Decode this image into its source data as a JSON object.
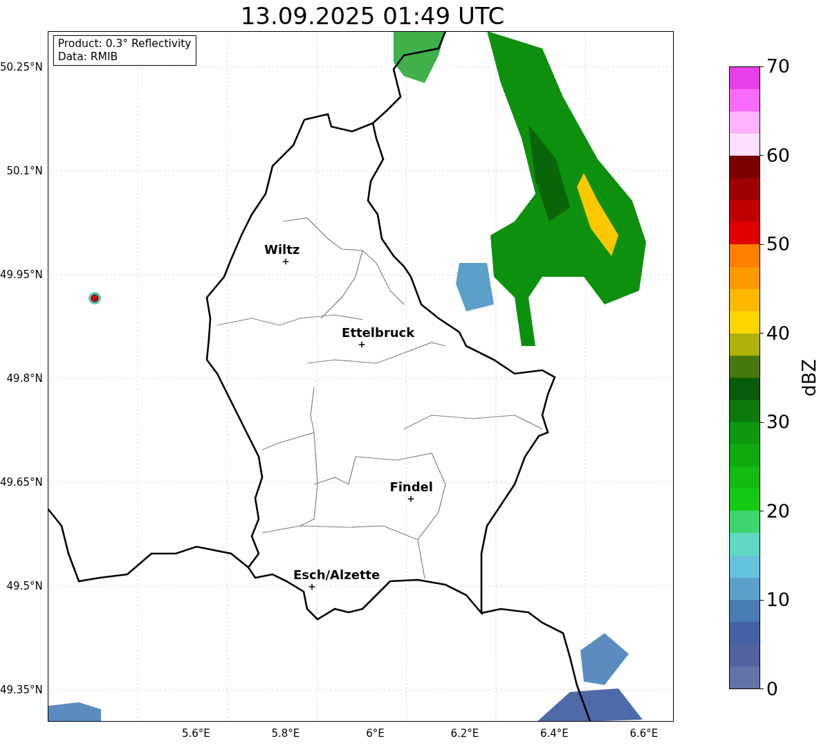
{
  "title": "13.09.2025 01:49 UTC",
  "info_box": [
    "Product: 0.3° Reflectivity",
    "Data: RMIB"
  ],
  "map": {
    "lat_ticks": [
      "50.25°N",
      "50.1°N",
      "49.95°N",
      "49.8°N",
      "49.65°N",
      "49.5°N",
      "49.35°N"
    ],
    "lon_ticks": [
      "5.6°E",
      "5.8°E",
      "6°E",
      "6.2°E",
      "6.4°E",
      "6.6°E"
    ],
    "places": [
      {
        "name": "Wiltz"
      },
      {
        "name": "Ettelbruck"
      },
      {
        "name": "Findel"
      },
      {
        "name": "Esch/Alzette"
      }
    ]
  },
  "colorbar": {
    "label": "dBZ",
    "ticks": [
      "70",
      "60",
      "50",
      "40",
      "30",
      "20",
      "10",
      "0"
    ],
    "bands": [
      {
        "color": "#6474a8"
      },
      {
        "color": "#52639f"
      },
      {
        "color": "#4460a6"
      },
      {
        "color": "#4b7db5"
      },
      {
        "color": "#5ba0c8"
      },
      {
        "color": "#64c2dc"
      },
      {
        "color": "#60d8c2"
      },
      {
        "color": "#3fd46c"
      },
      {
        "color": "#14c914"
      },
      {
        "color": "#12bc12"
      },
      {
        "color": "#10a910"
      },
      {
        "color": "#0e980e"
      },
      {
        "color": "#0c7a0c"
      },
      {
        "color": "#095c09"
      },
      {
        "color": "#47780b"
      },
      {
        "color": "#afb10a"
      },
      {
        "color": "#fdd600"
      },
      {
        "color": "#fdb900"
      },
      {
        "color": "#fd9a00"
      },
      {
        "color": "#fd7f00"
      },
      {
        "color": "#e00000"
      },
      {
        "color": "#c00000"
      },
      {
        "color": "#9c0000"
      },
      {
        "color": "#7a0000"
      },
      {
        "color": "#fee0fe"
      },
      {
        "color": "#fdb3fd"
      },
      {
        "color": "#fb6bfb"
      },
      {
        "color": "#e83ee8"
      }
    ]
  }
}
